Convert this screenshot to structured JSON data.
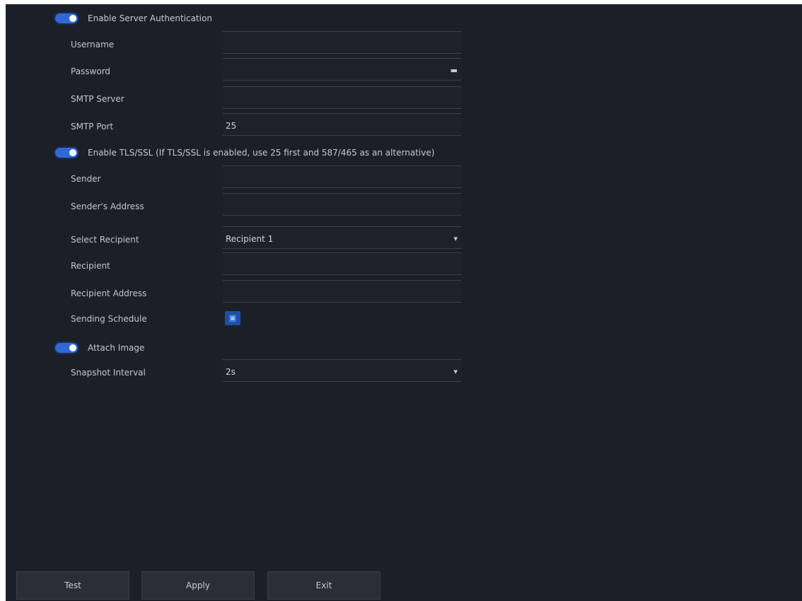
{
  "server_auth": {
    "toggle_label": "Enable Server Authentication",
    "enabled": true,
    "fields": [
      {
        "label": "Username",
        "value": ""
      },
      {
        "label": "Password",
        "value": "",
        "icon": "eye-icon"
      },
      {
        "label": "SMTP Server",
        "value": ""
      },
      {
        "label": "SMTP Port",
        "value": "25"
      }
    ]
  },
  "tls": {
    "toggle_label": "Enable TLS/SSL (If TLS/SSL is enabled, use 25 first and 587/465 as an alternative)",
    "enabled": true
  },
  "sender": {
    "fields": [
      {
        "label": "Sender",
        "value": ""
      },
      {
        "label": "Sender's Address",
        "value": ""
      }
    ]
  },
  "recipient": {
    "select_label": "Select Recipient",
    "select_value": "Recipient 1",
    "select_icon": "chevron-down-icon",
    "fields": [
      {
        "label": "Recipient",
        "value": ""
      },
      {
        "label": "Recipient Address",
        "value": ""
      }
    ]
  },
  "schedule": {
    "label": "Sending Schedule",
    "button_icon": "schedule-icon",
    "button_glyph": "▣"
  },
  "attach": {
    "toggle_label": "Attach Image",
    "enabled": true,
    "interval_label": "Snapshot Interval",
    "interval_value": "2s",
    "interval_icon": "chevron-down-icon"
  },
  "footer": {
    "test_label": "Test",
    "apply_label": "Apply",
    "exit_label": "Exit"
  },
  "colors": {
    "background": "#1b1f27",
    "accent": "#2f69d8"
  }
}
